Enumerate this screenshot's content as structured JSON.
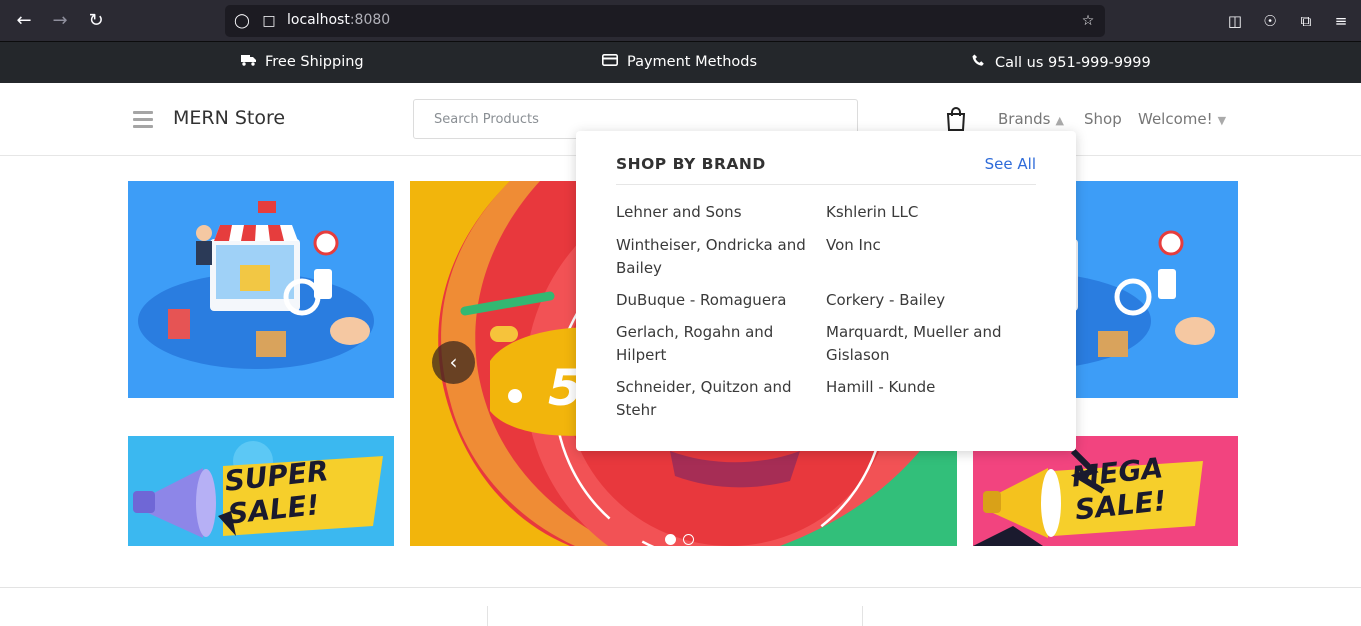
{
  "browser": {
    "url_host": "localhost",
    "url_port": ":8080"
  },
  "info_bar": {
    "shipping": "Free Shipping",
    "payment": "Payment Methods",
    "call": "Call us 951-999-9999"
  },
  "header": {
    "logo": "MERN Store",
    "search_placeholder": "Search Products",
    "nav": {
      "brands": "Brands",
      "shop": "Shop",
      "welcome": "Welcome!"
    }
  },
  "dropdown": {
    "title": "SHOP BY BRAND",
    "see_all": "See All",
    "brands": [
      "Lehner and Sons",
      "Kshlerin LLC",
      "Wintheiser, Ondricka and Bailey",
      "Von Inc",
      "DuBuque - Romaguera",
      "Corkery - Bailey",
      "Gerlach, Rogahn and Hilpert",
      "Marquardt, Mueller and Gislason",
      "Schneider, Quitzon and Stehr",
      "Hamill - Kunde"
    ]
  },
  "banners": {
    "left_sale": "SUPER SALE!",
    "right_sale": "MEGA SALE!",
    "center_digit": "5"
  },
  "colors": {
    "info_bar_bg": "#24272b",
    "accent_link": "#2e6bd9",
    "banner_blue": "#3d9df7",
    "banner_red": "#e8383d",
    "banner_pink": "#f2447f"
  }
}
